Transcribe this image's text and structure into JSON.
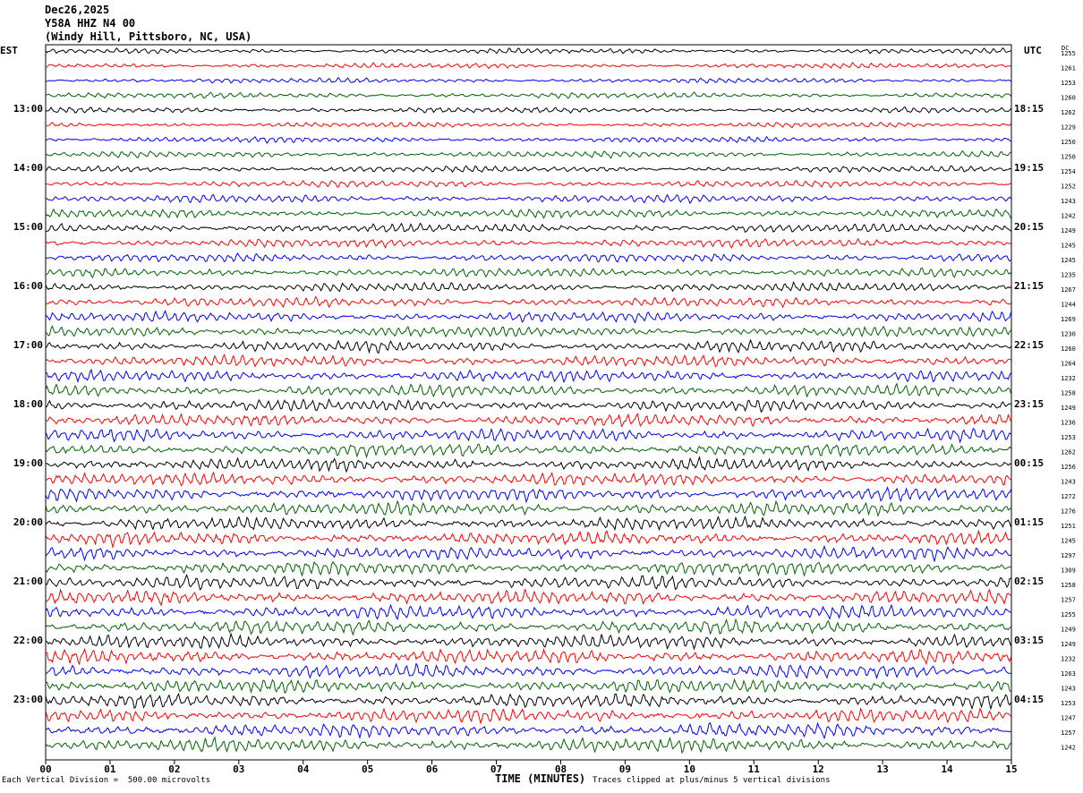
{
  "header": {
    "date": "Dec26,2025",
    "station": "Y58A HHZ N4 00",
    "location": "(Windy Hill, Pittsboro, NC, USA)"
  },
  "footer": {
    "scale_note": "Each Vertical Division =  500.00 microvolts",
    "xlabel": "TIME (MINUTES)",
    "clip_note": "Traces clipped at plus/minus 5 vertical divisions"
  },
  "colors": {
    "black": "#000000",
    "red": "#ff0000",
    "blue": "#0000ff",
    "green": "#006400"
  },
  "chart_data": {
    "type": "line",
    "left_axis_label": "EST",
    "right_axis_label": "UTC",
    "dc_label": "DC",
    "xlabel": "TIME (MINUTES)",
    "xlim": [
      0,
      15
    ],
    "x_ticks": [
      "00",
      "01",
      "02",
      "03",
      "04",
      "05",
      "06",
      "07",
      "08",
      "09",
      "10",
      "11",
      "12",
      "13",
      "14",
      "15"
    ],
    "traces_per_hour": 4,
    "trace_color_cycle": [
      "black",
      "red",
      "blue",
      "green"
    ],
    "left_hour_labels": [
      {
        "trace": 4,
        "label": "13:00"
      },
      {
        "trace": 8,
        "label": "14:00"
      },
      {
        "trace": 12,
        "label": "15:00"
      },
      {
        "trace": 16,
        "label": "16:00"
      },
      {
        "trace": 20,
        "label": "17:00"
      },
      {
        "trace": 24,
        "label": "18:00"
      },
      {
        "trace": 28,
        "label": "19:00"
      },
      {
        "trace": 32,
        "label": "20:00"
      },
      {
        "trace": 36,
        "label": "21:00"
      },
      {
        "trace": 40,
        "label": "22:00"
      },
      {
        "trace": 44,
        "label": "23:00"
      }
    ],
    "right_hour_labels": [
      {
        "trace": 4,
        "label": "18:15"
      },
      {
        "trace": 8,
        "label": "19:15"
      },
      {
        "trace": 12,
        "label": "20:15"
      },
      {
        "trace": 16,
        "label": "21:15"
      },
      {
        "trace": 20,
        "label": "22:15"
      },
      {
        "trace": 24,
        "label": "23:15"
      },
      {
        "trace": 28,
        "label": "00:15"
      },
      {
        "trace": 32,
        "label": "01:15"
      },
      {
        "trace": 36,
        "label": "02:15"
      },
      {
        "trace": 40,
        "label": "03:15"
      },
      {
        "trace": 44,
        "label": "04:15"
      }
    ],
    "dc_offsets": [
      1255,
      1261,
      1253,
      1260,
      1262,
      1229,
      1250,
      1250,
      1254,
      1252,
      1243,
      1242,
      1249,
      1245,
      1245,
      1235,
      1267,
      1244,
      1269,
      1230,
      1260,
      1264,
      1232,
      1258,
      1249,
      1236,
      1253,
      1262,
      1256,
      1243,
      1272,
      1276,
      1251,
      1245,
      1297,
      1309,
      1258,
      1257,
      1255,
      1249,
      1249,
      1232,
      1263,
      1243,
      1253,
      1247,
      1257,
      1242
    ],
    "amplitude_envelope": [
      0.45,
      0.45,
      0.45,
      0.5,
      0.5,
      0.45,
      0.5,
      0.55,
      0.55,
      0.6,
      0.7,
      0.75,
      0.8,
      0.75,
      0.75,
      0.75,
      0.8,
      0.85,
      0.9,
      0.95,
      1.0,
      1.0,
      1.0,
      1.05,
      1.05,
      1.05,
      1.1,
      1.1,
      1.1,
      1.1,
      1.15,
      1.15,
      1.15,
      1.15,
      1.15,
      1.2,
      1.15,
      1.2,
      1.2,
      1.2,
      1.2,
      1.2,
      1.2,
      1.2,
      1.2,
      1.2,
      1.2,
      1.2
    ]
  }
}
